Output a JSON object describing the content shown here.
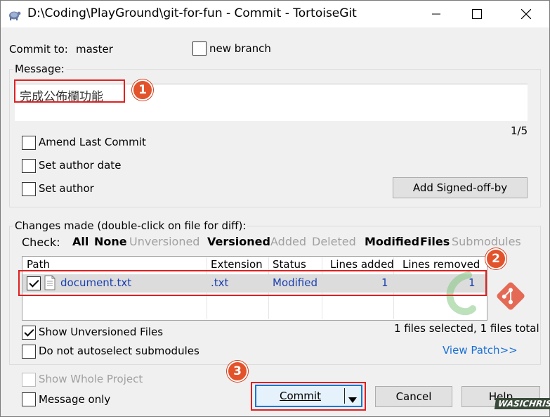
{
  "window": {
    "title": "D:\\Coding\\PlayGround\\git-for-fun - Commit - TortoiseGit"
  },
  "header": {
    "commit_to_label": "Commit to:",
    "branch": "master",
    "new_branch_label": "new branch"
  },
  "message": {
    "group_label": "Message:",
    "text": "完成公佈欄功能",
    "counter": "1/5",
    "amend_label": "Amend Last Commit",
    "set_author_date_label": "Set author date",
    "set_author_label": "Set author",
    "add_signed_off_label": "Add Signed-off-by"
  },
  "changes": {
    "group_label": "Changes made (double-click on file for diff):",
    "check_label": "Check:",
    "filters": [
      {
        "label": "All",
        "active": true
      },
      {
        "label": "None",
        "active": true
      },
      {
        "label": "Unversioned",
        "active": false
      },
      {
        "label": "Versioned",
        "active": true
      },
      {
        "label": "Added",
        "active": false
      },
      {
        "label": "Deleted",
        "active": false
      },
      {
        "label": "Modified",
        "active": true
      },
      {
        "label": "Files",
        "active": true
      },
      {
        "label": "Submodules",
        "active": false
      }
    ],
    "columns": [
      "Path",
      "Extension",
      "Status",
      "Lines added",
      "Lines removed"
    ],
    "rows": [
      {
        "path": "document.txt",
        "extension": ".txt",
        "status": "Modified",
        "lines_added": "1",
        "lines_removed": "1",
        "checked": true
      }
    ],
    "show_unversioned_label": "Show Unversioned Files",
    "no_autoselect_label": "Do not autoselect submodules",
    "selection_summary": "1 files selected, 1 files total",
    "view_patch_label": "View Patch>>"
  },
  "footer": {
    "show_whole_project_label": "Show Whole Project",
    "message_only_label": "Message only",
    "commit_label": "Commit",
    "cancel_label": "Cancel",
    "help_label": "Help"
  },
  "annotations": {
    "step1": "1",
    "step2": "2",
    "step3": "3"
  },
  "watermark": "WASICHRIS",
  "colors": {
    "accent_red": "#e02020",
    "badge": "#e2532c",
    "link_blue": "#1a6fd6",
    "cell_blue": "#1a3fb0",
    "disabled": "#a0a0a0"
  }
}
